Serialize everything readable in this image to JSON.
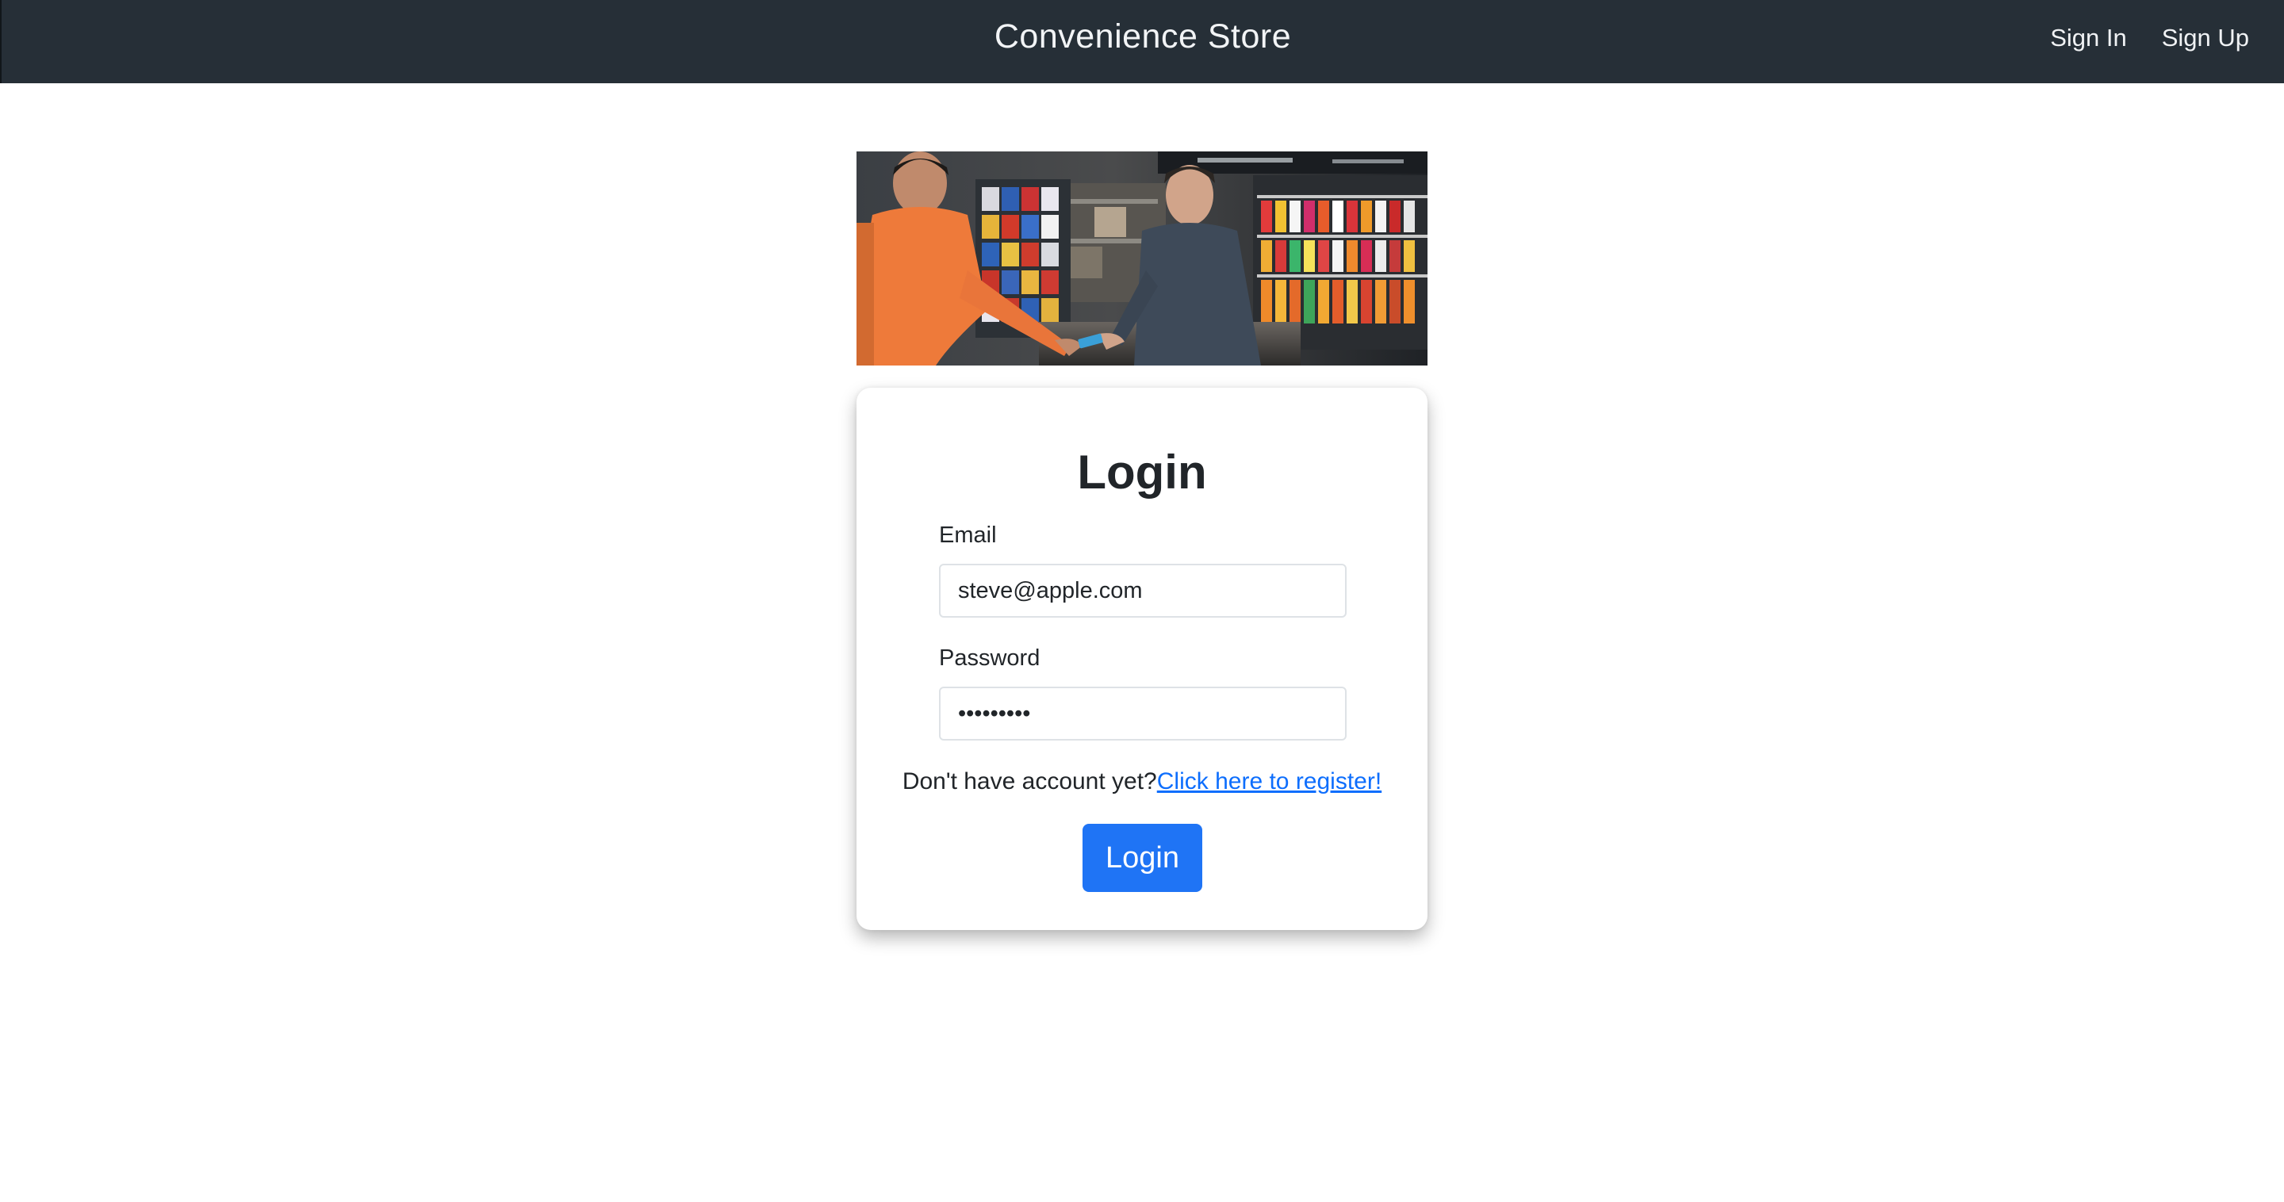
{
  "navbar": {
    "brand": "Convenience Store",
    "links": [
      "Sign In",
      "Sign Up"
    ]
  },
  "banner": {
    "icon": "store-checkout-photo"
  },
  "login_form": {
    "title": "Login",
    "email_label": "Email",
    "email_value": "steve@apple.com",
    "password_label": "Password",
    "password_value": "•••••••••",
    "register_prompt": "Don't have account yet?",
    "register_link": "Click here to register!",
    "submit_label": "Login"
  },
  "colors": {
    "navbar_bg": "#262f37",
    "primary": "#1f74f5",
    "link": "#0d6efd"
  }
}
